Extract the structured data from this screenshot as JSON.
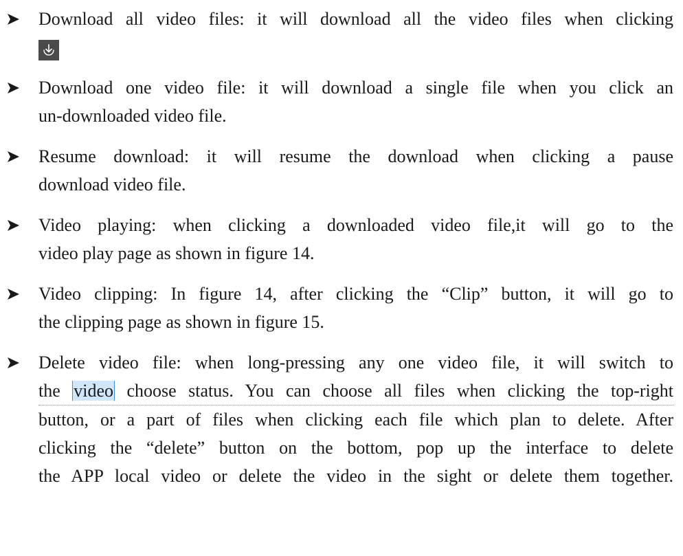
{
  "items": [
    {
      "lines": [
        "Download all video files: it will download all the video files when clicking"
      ],
      "has_icon": true,
      "icon": "download-arrow-icon"
    },
    {
      "lines": [
        "Download one video file: it will download a single file when you click an",
        "un-downloaded video file."
      ]
    },
    {
      "lines": [
        "Resume download: it will resume the download when clicking a pause",
        "download video file."
      ]
    },
    {
      "lines": [
        "Video playing: when clicking a downloaded video file,it will go to the",
        "video play page as shown in figure 14."
      ]
    },
    {
      "lines": [
        "Video clipping: In figure 14, after clicking the “Clip” button, it will go to",
        "the clipping page as shown in figure 15."
      ]
    },
    {
      "line1": "Delete video file: when long-pressing any one video file, it will switch to",
      "line2_pre": "the ",
      "line2_hl": "video",
      "line2_post": " choose status. You can choose all files when clicking the top-right",
      "line3": "button, or a part of files when clicking each file which plan to delete. After",
      "line4": "clicking the “delete” button on the bottom, pop up the interface to delete",
      "line5": "the APP local video or delete the video in the sight or delete them together."
    }
  ],
  "colors": {
    "text": "#1a1a1a",
    "highlight": "#cfe6fb",
    "caret": "#3b8ee5",
    "icon_bg": "#4a4a4a"
  }
}
